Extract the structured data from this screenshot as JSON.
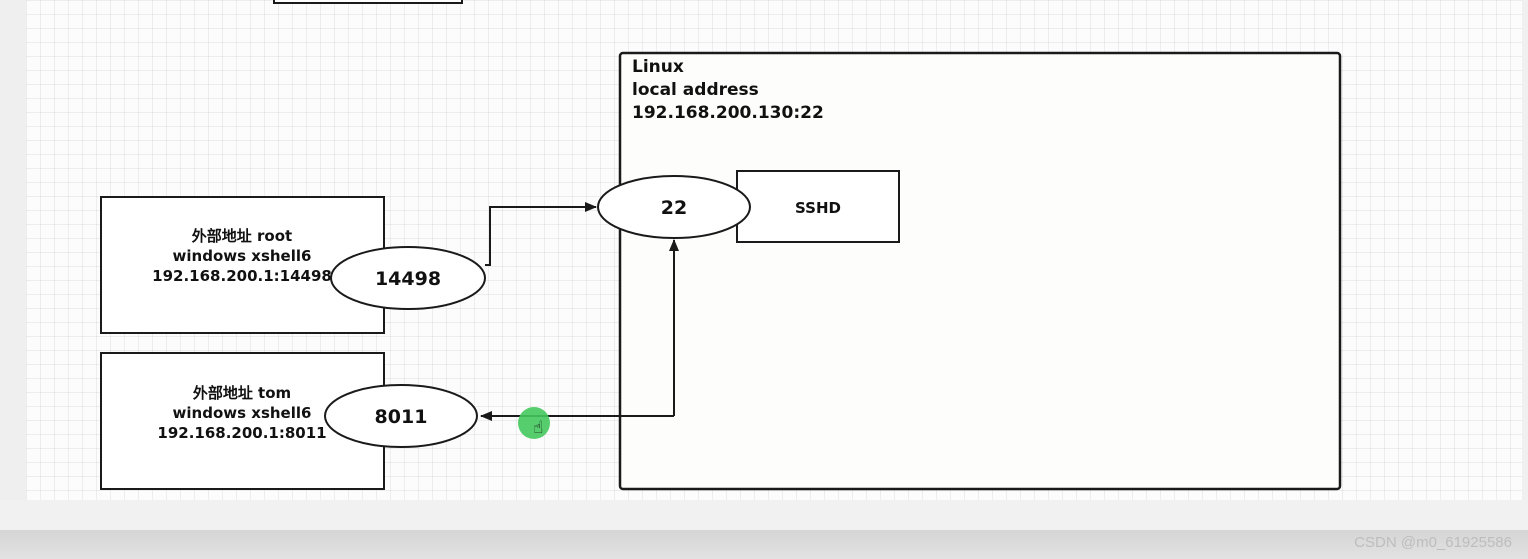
{
  "linux_box": {
    "lines": [
      "Linux",
      "local address",
      "192.168.200.130:22"
    ]
  },
  "port_22": {
    "label": "22"
  },
  "sshd": {
    "label": "SSHD"
  },
  "client_root": {
    "lines": [
      "外部地址 root",
      "windows xshell6",
      "192.168.200.1:14498"
    ],
    "port_label": "14498"
  },
  "client_tom": {
    "lines": [
      "外部地址 tom",
      "windows xshell6",
      "192.168.200.1:8011"
    ],
    "port_label": "8011"
  },
  "watermark": "CSDN @m0_61925586",
  "colors": {
    "stroke": "#1a1a1a",
    "box_fill": "#ffffff",
    "cursor_highlight": "#45c95e"
  },
  "icons": {
    "cursor": "hand-pointer-icon"
  }
}
